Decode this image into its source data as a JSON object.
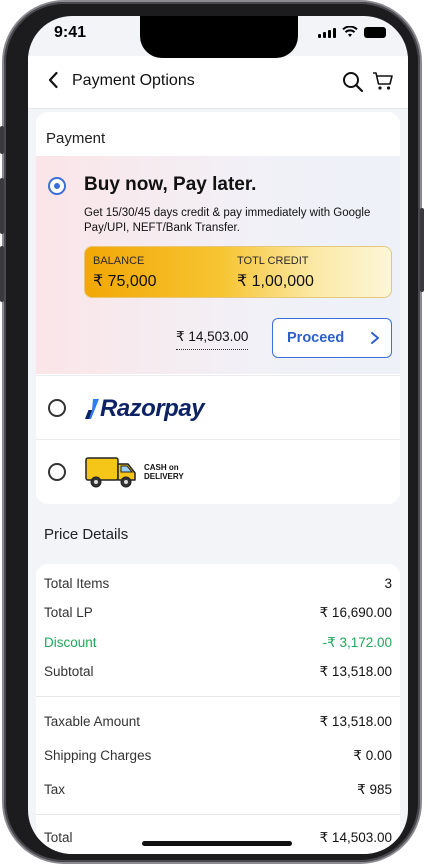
{
  "status": {
    "time": "9:41"
  },
  "header": {
    "title": "Payment Options"
  },
  "payment": {
    "section_title": "Payment",
    "bnpl": {
      "title": "Buy now, Pay later.",
      "description": "Get 15/30/45 days credit & pay immediately with Google Pay/UPI, NEFT/Bank Transfer.",
      "balance_label": "BALANCE",
      "balance_value": "₹ 75,000",
      "credit_label": "TOTL CREDIT",
      "credit_value": "₹ 1,00,000",
      "amount": "₹ 14,503.00",
      "proceed_label": "Proceed",
      "selected": true
    },
    "razorpay": {
      "logo_text": "Razorpay"
    },
    "cod": {
      "line1": "CASH on",
      "line2": "DELIVERY"
    }
  },
  "price_details": {
    "title": "Price Details",
    "rows": [
      {
        "label": "Total Items",
        "value": "3"
      },
      {
        "label": "Total LP",
        "value": "₹ 16,690.00"
      },
      {
        "label": "Discount",
        "value": "-₹ 3,172.00"
      },
      {
        "label": "Subtotal",
        "value": "₹ 13,518.00"
      },
      {
        "label": "Taxable Amount",
        "value": "₹ 13,518.00"
      },
      {
        "label": "Shipping Charges",
        "value": "₹ 0.00"
      },
      {
        "label": "Tax",
        "value": "₹ 985"
      },
      {
        "label": "Total",
        "value": "₹ 14,503.00"
      }
    ]
  },
  "colors": {
    "accent": "#3b6fd8",
    "discount": "#1fa75a",
    "credit_gold": "#f2a705"
  }
}
